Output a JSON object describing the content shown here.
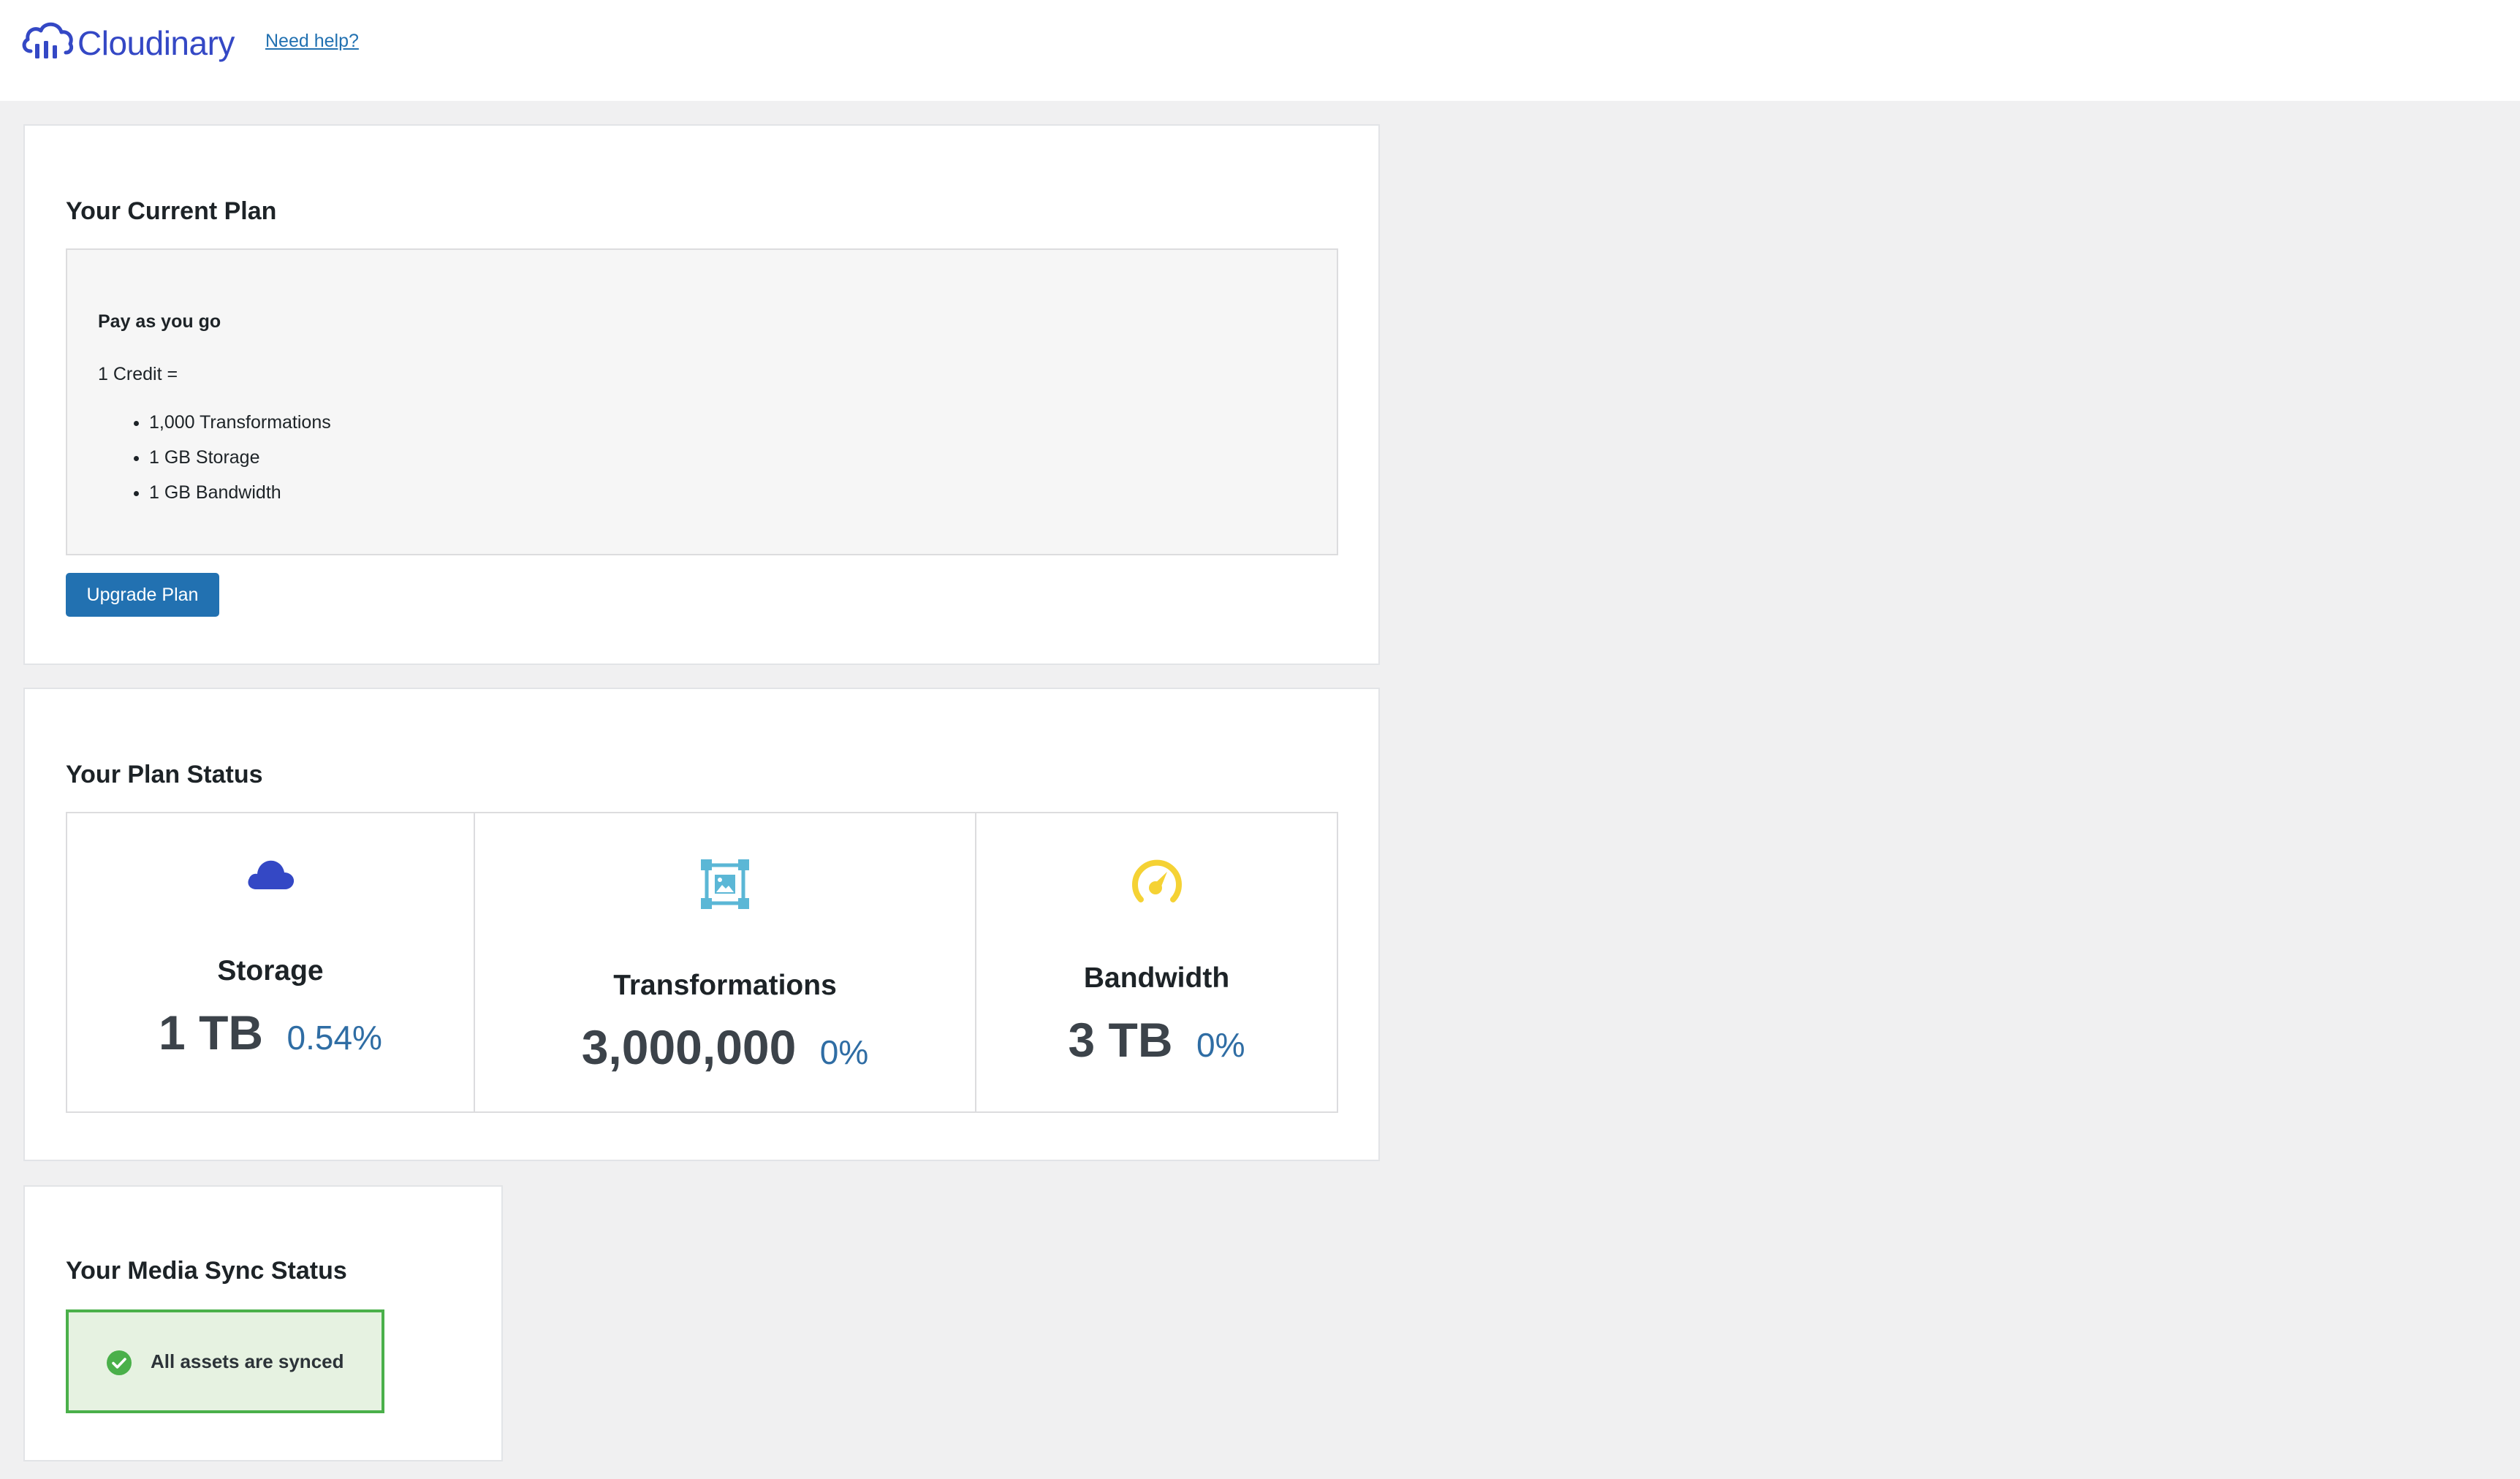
{
  "header": {
    "brand_name": "Cloudinary",
    "brand_icon": "cloudinary-logo-icon",
    "help_link": "Need help?"
  },
  "current_plan": {
    "title": "Your Current Plan",
    "plan_name": "Pay as you go",
    "credit_label": "1 Credit =",
    "credit_items": [
      "1,000 Transformations",
      "1 GB Storage",
      "1 GB Bandwidth"
    ],
    "upgrade_button": "Upgrade Plan"
  },
  "plan_status": {
    "title": "Your Plan Status",
    "stats": [
      {
        "label": "Storage",
        "amount": "1 TB",
        "percent": "0.54%",
        "icon": "cloud-icon",
        "icon_color": "#3448c5"
      },
      {
        "label": "Transformations",
        "amount": "3,000,000",
        "percent": "0%",
        "icon": "image-transform-icon",
        "icon_color": "#5bb7d6"
      },
      {
        "label": "Bandwidth",
        "amount": "3 TB",
        "percent": "0%",
        "icon": "speedometer-icon",
        "icon_color": "#f5d234"
      }
    ]
  },
  "media_sync": {
    "title": "Your Media Sync Status",
    "status_text": "All assets are synced",
    "status_icon": "check-circle-icon",
    "status_color": "#4ab04a"
  },
  "colors": {
    "primary": "#2271b1",
    "brand": "#3448c5",
    "percent_text": "#2f6da4",
    "page_background": "#f0f0f1"
  }
}
